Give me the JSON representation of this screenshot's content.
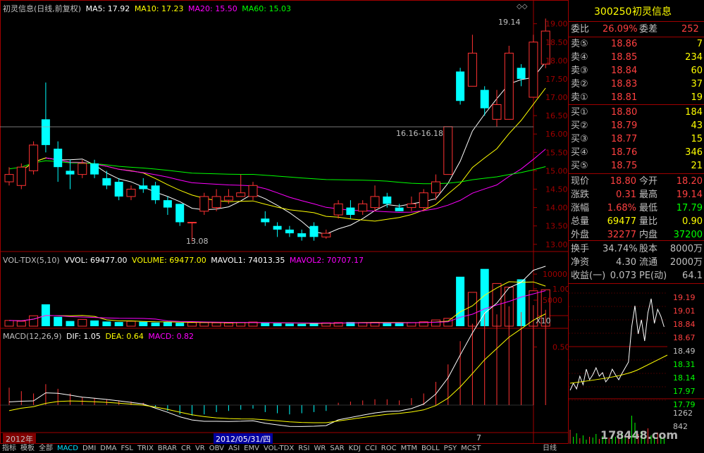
{
  "stock": {
    "code": "300250",
    "name": "初灵信息",
    "chart_title": "初灵信息(日线,前复权)"
  },
  "ma_legend": [
    {
      "label": "MA5: 17.92",
      "color": "#ffffff"
    },
    {
      "label": "MA10: 17.23",
      "color": "#ffff00"
    },
    {
      "label": "MA20: 15.50",
      "color": "#ff00ff"
    },
    {
      "label": "MA60: 15.03",
      "color": "#00ff00"
    }
  ],
  "price_axis": [
    "19.00",
    "18.50",
    "18.00",
    "17.50",
    "17.00",
    "16.50",
    "16.00",
    "15.50",
    "15.00",
    "14.50",
    "14.00",
    "13.50",
    "13.00"
  ],
  "price_annotations": {
    "high": "19.14",
    "low": "13.08",
    "gap": "16.16-16.18"
  },
  "vol_legend": [
    {
      "label": "VOL-TDX(5,10)",
      "color": "#c0c0c0"
    },
    {
      "label": "VVOL: 69477.00",
      "color": "#ffffff"
    },
    {
      "label": "VOLUME: 69477.00",
      "color": "#ffff00"
    },
    {
      "label": "MAVOL1: 74013.35",
      "color": "#ffffff"
    },
    {
      "label": "MAVOL2: 70707.17",
      "color": "#ff00ff"
    }
  ],
  "vol_axis": [
    "10000",
    "5000"
  ],
  "vol_unit": "X10",
  "macd_legend": [
    {
      "label": "MACD(12,26,9)",
      "color": "#c0c0c0"
    },
    {
      "label": "DIF: 1.05",
      "color": "#ffffff"
    },
    {
      "label": "DEA: 0.64",
      "color": "#ffff00"
    },
    {
      "label": "MACD: 0.82",
      "color": "#ff00ff"
    }
  ],
  "macd_axis": [
    "1.00",
    "0.50"
  ],
  "date_bar": {
    "year": "2012年",
    "cursor_date": "2012/05/31/四",
    "month": "7"
  },
  "quote": {
    "wei_bi_label": "委比",
    "wei_bi": "26.09%",
    "wei_cha_label": "委差",
    "wei_cha": "252",
    "asks": [
      {
        "label": "卖⑤",
        "price": "18.86",
        "vol": "7"
      },
      {
        "label": "卖④",
        "price": "18.85",
        "vol": "234"
      },
      {
        "label": "卖③",
        "price": "18.84",
        "vol": "60"
      },
      {
        "label": "卖②",
        "price": "18.83",
        "vol": "37"
      },
      {
        "label": "卖①",
        "price": "18.81",
        "vol": "19"
      }
    ],
    "bids": [
      {
        "label": "买①",
        "price": "18.80",
        "vol": "184"
      },
      {
        "label": "买②",
        "price": "18.79",
        "vol": "43"
      },
      {
        "label": "买③",
        "price": "18.77",
        "vol": "15"
      },
      {
        "label": "买④",
        "price": "18.76",
        "vol": "346"
      },
      {
        "label": "买⑤",
        "price": "18.75",
        "vol": "21"
      }
    ],
    "stats": [
      {
        "l1": "现价",
        "v1": "18.80",
        "l2": "今开",
        "v2": "18.20"
      },
      {
        "l1": "涨跌",
        "v1": "0.31",
        "l2": "最高",
        "v2": "19.14"
      },
      {
        "l1": "涨幅",
        "v1": "1.68%",
        "l2": "最低",
        "v2": "17.79"
      },
      {
        "l1": "总量",
        "v1": "69477",
        "l2": "量比",
        "v2": "0.90"
      },
      {
        "l1": "外盘",
        "v1": "32277",
        "l2": "内盘",
        "v2": "37200"
      }
    ],
    "stats2": [
      {
        "l1": "换手",
        "v1": "34.74%",
        "l2": "股本",
        "v2": "8000万"
      },
      {
        "l1": "净资",
        "v1": "4.30",
        "l2": "流通",
        "v2": "2000万"
      },
      {
        "l1": "收益(一)",
        "v1": "0.073",
        "l2": "PE(动)",
        "v2": "64.1"
      }
    ]
  },
  "mini_chart": {
    "price_labels": [
      "19.19",
      "19.01",
      "18.84",
      "18.67",
      "18.49",
      "18.31",
      "18.14",
      "17.97",
      "17.79"
    ],
    "vol_labels": [
      "1262",
      "842"
    ]
  },
  "tabs": [
    "指标",
    "模板",
    "全部",
    "MACD",
    "DMI",
    "DMA",
    "FSL",
    "TRIX",
    "BRAR",
    "CR",
    "VR",
    "OBV",
    "ASI",
    "EMV",
    "VOL-TDX",
    "RSI",
    "WR",
    "SAR",
    "KDJ",
    "CCI",
    "ROC",
    "MTM",
    "BOLL",
    "PSY",
    "MCST"
  ],
  "right_tab": "日线",
  "watermark": "178448.com",
  "chart_data": {
    "type": "candlestick",
    "title": "初灵信息(日线,前复权)",
    "ylim": [
      12.9,
      19.3
    ],
    "candles": [
      {
        "o": 14.7,
        "c": 14.9,
        "h": 15.1,
        "l": 14.6
      },
      {
        "o": 14.6,
        "c": 15.1,
        "h": 15.2,
        "l": 14.5
      },
      {
        "o": 15.0,
        "c": 15.7,
        "h": 15.8,
        "l": 14.9
      },
      {
        "o": 16.4,
        "c": 15.7,
        "h": 17.4,
        "l": 15.5
      },
      {
        "o": 15.6,
        "c": 15.1,
        "h": 15.8,
        "l": 14.7
      },
      {
        "o": 15.0,
        "c": 14.9,
        "h": 15.3,
        "l": 14.5
      },
      {
        "o": 14.9,
        "c": 15.2,
        "h": 15.3,
        "l": 14.8
      },
      {
        "o": 15.2,
        "c": 14.9,
        "h": 15.3,
        "l": 14.8
      },
      {
        "o": 14.8,
        "c": 14.6,
        "h": 15.0,
        "l": 14.5
      },
      {
        "o": 14.7,
        "c": 14.3,
        "h": 14.8,
        "l": 14.2
      },
      {
        "o": 14.3,
        "c": 14.5,
        "h": 14.6,
        "l": 14.2
      },
      {
        "o": 14.6,
        "c": 14.5,
        "h": 14.8,
        "l": 14.4
      },
      {
        "o": 14.6,
        "c": 14.2,
        "h": 14.7,
        "l": 14.1
      },
      {
        "o": 14.2,
        "c": 14.0,
        "h": 14.3,
        "l": 13.8
      },
      {
        "o": 14.1,
        "c": 13.6,
        "h": 14.1,
        "l": 13.5
      },
      {
        "o": 13.6,
        "c": 13.6,
        "h": 13.6,
        "l": 13.08
      },
      {
        "o": 13.9,
        "c": 14.3,
        "h": 14.4,
        "l": 13.8
      },
      {
        "o": 14.0,
        "c": 14.3,
        "h": 14.5,
        "l": 13.9
      },
      {
        "o": 14.2,
        "c": 14.3,
        "h": 14.5,
        "l": 14.1
      },
      {
        "o": 14.3,
        "c": 14.4,
        "h": 14.9,
        "l": 14.3
      },
      {
        "o": 14.3,
        "c": 14.6,
        "h": 14.7,
        "l": 14.2
      },
      {
        "o": 13.7,
        "c": 13.6,
        "h": 13.9,
        "l": 13.5
      },
      {
        "o": 13.5,
        "c": 13.4,
        "h": 13.6,
        "l": 13.2
      },
      {
        "o": 13.4,
        "c": 13.3,
        "h": 13.5,
        "l": 13.2
      },
      {
        "o": 13.3,
        "c": 13.2,
        "h": 13.4,
        "l": 13.1
      },
      {
        "o": 13.5,
        "c": 13.2,
        "h": 13.6,
        "l": 13.1
      },
      {
        "o": 13.2,
        "c": 13.3,
        "h": 13.4,
        "l": 13.15
      },
      {
        "o": 13.8,
        "c": 14.1,
        "h": 14.2,
        "l": 13.7
      },
      {
        "o": 14.0,
        "c": 13.8,
        "h": 14.2,
        "l": 13.7
      },
      {
        "o": 13.9,
        "c": 14.1,
        "h": 14.2,
        "l": 13.8
      },
      {
        "o": 14.0,
        "c": 14.3,
        "h": 14.6,
        "l": 13.9
      },
      {
        "o": 14.3,
        "c": 14.1,
        "h": 14.4,
        "l": 14.0
      },
      {
        "o": 14.0,
        "c": 13.9,
        "h": 14.1,
        "l": 13.9
      },
      {
        "o": 14.0,
        "c": 14.1,
        "h": 14.3,
        "l": 13.9
      },
      {
        "o": 14.0,
        "c": 14.4,
        "h": 14.5,
        "l": 13.9
      },
      {
        "o": 14.4,
        "c": 14.7,
        "h": 14.9,
        "l": 14.2
      },
      {
        "o": 14.9,
        "c": 16.2,
        "h": 16.2,
        "l": 14.9
      },
      {
        "o": 17.7,
        "c": 16.9,
        "h": 17.8,
        "l": 16.8
      },
      {
        "o": 17.3,
        "c": 18.2,
        "h": 18.7,
        "l": 17.3
      },
      {
        "o": 17.2,
        "c": 16.7,
        "h": 17.3,
        "l": 16.5
      },
      {
        "o": 16.4,
        "c": 16.8,
        "h": 17.2,
        "l": 16.2
      },
      {
        "o": 16.4,
        "c": 18.2,
        "h": 18.4,
        "l": 16.4
      },
      {
        "o": 17.8,
        "c": 17.5,
        "h": 17.9,
        "l": 17.3
      },
      {
        "o": 17.0,
        "c": 18.5,
        "h": 18.7,
        "l": 17.0
      },
      {
        "o": 17.9,
        "c": 18.8,
        "h": 19.14,
        "l": 17.79
      }
    ],
    "volume": [
      1100,
      950,
      2000,
      4200,
      1800,
      1000,
      1300,
      1100,
      900,
      800,
      950,
      850,
      700,
      800,
      650,
      700,
      700,
      650,
      600,
      700,
      800,
      600,
      550,
      500,
      450,
      600,
      650,
      700,
      800,
      700,
      750,
      650,
      600,
      700,
      850,
      1200,
      1500,
      9500,
      6500,
      11000,
      8200,
      7500,
      9000,
      6800,
      7000
    ],
    "macd_bars": [
      0.15,
      0.12,
      0.1,
      0.18,
      0.14,
      0.1,
      0.07,
      0.06,
      0.05,
      0.04,
      0.03,
      0.02,
      -0.02,
      -0.05,
      -0.08,
      -0.09,
      -0.08,
      -0.06,
      -0.05,
      -0.04,
      -0.03,
      -0.06,
      -0.07,
      -0.08,
      -0.07,
      -0.06,
      -0.05,
      0.02,
      0.03,
      0.04,
      0.05,
      0.05,
      0.04,
      0.06,
      0.1,
      0.2,
      0.35,
      0.55,
      0.7,
      0.8,
      0.78,
      0.85,
      0.8,
      0.86,
      0.82
    ]
  }
}
